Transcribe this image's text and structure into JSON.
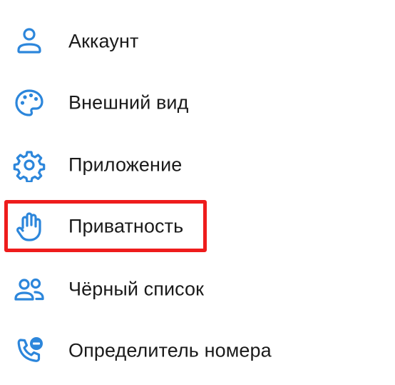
{
  "settings": {
    "items": [
      {
        "label": "Аккаунт",
        "icon": "person-icon"
      },
      {
        "label": "Внешний вид",
        "icon": "palette-icon"
      },
      {
        "label": "Приложение",
        "icon": "gear-icon"
      },
      {
        "label": "Приватность",
        "icon": "hand-icon",
        "highlighted": true
      },
      {
        "label": "Чёрный список",
        "icon": "users-icon"
      },
      {
        "label": "Определитель номера",
        "icon": "phone-block-icon"
      }
    ]
  },
  "colors": {
    "icon": "#2c86db",
    "text": "#1a1a1a",
    "highlight": "#ee1c1c",
    "background": "#ffffff"
  }
}
